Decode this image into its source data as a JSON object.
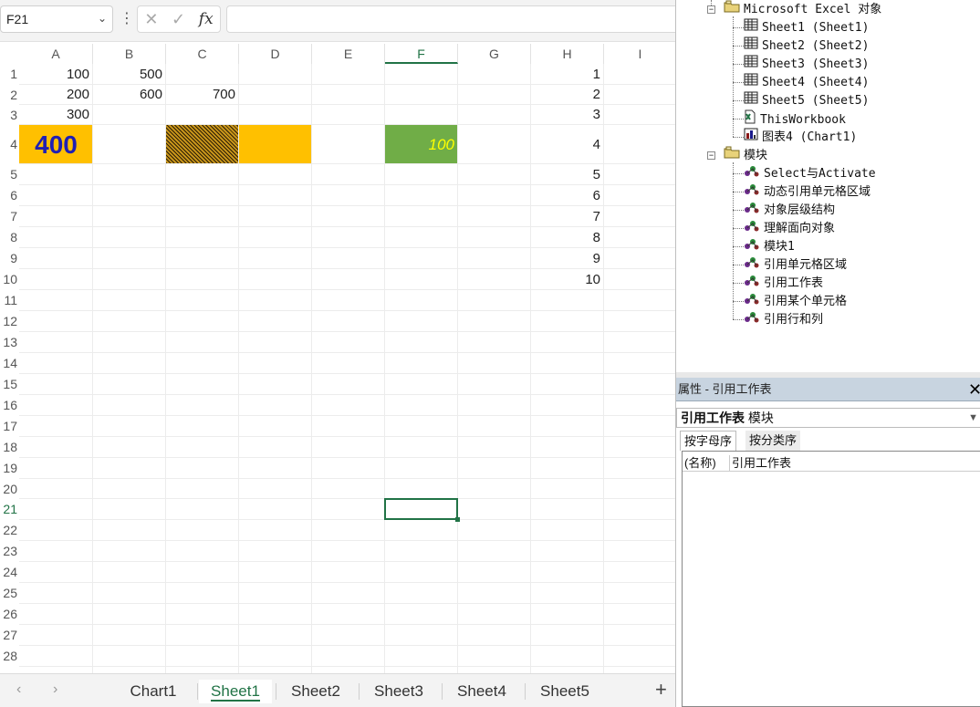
{
  "formula_bar": {
    "name_box": "F21",
    "more": "⋮",
    "cancel": "✕",
    "confirm": "✓",
    "fx": "fx",
    "content": ""
  },
  "columns": [
    "A",
    "B",
    "C",
    "D",
    "E",
    "F",
    "G",
    "H",
    "I"
  ],
  "active_column": "F",
  "rows": [
    "1",
    "2",
    "3",
    "4",
    "5",
    "6",
    "7",
    "8",
    "9",
    "10",
    "11",
    "12",
    "13",
    "14",
    "15",
    "16",
    "17",
    "18",
    "19",
    "20",
    "21",
    "22",
    "23",
    "24",
    "25",
    "26",
    "27",
    "28"
  ],
  "active_row": "21",
  "cells": {
    "A1": "100",
    "B1": "500",
    "A2": "200",
    "B2": "600",
    "C2": "700",
    "A3": "300",
    "A4": "400",
    "F4": "100",
    "H1": "1",
    "H2": "2",
    "H3": "3",
    "H4": "4",
    "H5": "5",
    "H6": "6",
    "H7": "7",
    "H8": "8",
    "H9": "9",
    "H10": "10"
  },
  "cell_styles": {
    "A4": {
      "fill": "#ffc000",
      "color": "#1f1fb4",
      "bold": true
    },
    "C4": {
      "fill": "#7a5a10",
      "pattern": "hatch"
    },
    "D4": {
      "fill": "#ffc000"
    },
    "F4": {
      "fill": "#70ad47",
      "color": "#ffff00",
      "italic": true
    }
  },
  "sheet_tabs": {
    "prev": "‹",
    "next": "›",
    "tabs": [
      "Chart1",
      "Sheet1",
      "Sheet2",
      "Sheet3",
      "Sheet4",
      "Sheet5"
    ],
    "active": "Sheet1",
    "add": "+"
  },
  "vba": {
    "tree": {
      "excel_objects_folder": "Microsoft Excel 对象",
      "sheets": [
        "Sheet1 (Sheet1)",
        "Sheet2 (Sheet2)",
        "Sheet3 (Sheet3)",
        "Sheet4 (Sheet4)",
        "Sheet5 (Sheet5)"
      ],
      "workbook": "ThisWorkbook",
      "chart": "图表4 (Chart1)",
      "modules_folder": "模块",
      "modules": [
        "Select与Activate",
        "动态引用单元格区域",
        "对象层级结构",
        "理解面向对象",
        "模块1",
        "引用单元格区域",
        "引用工作表",
        "引用某个单元格",
        "引用行和列"
      ]
    },
    "properties": {
      "title": "属性 - 引用工作表",
      "close": "✕",
      "object_name": "引用工作表",
      "object_type": "模块",
      "tab_alpha": "按字母序",
      "tab_category": "按分类序",
      "prop_name": "(名称)",
      "prop_value": "引用工作表"
    }
  }
}
